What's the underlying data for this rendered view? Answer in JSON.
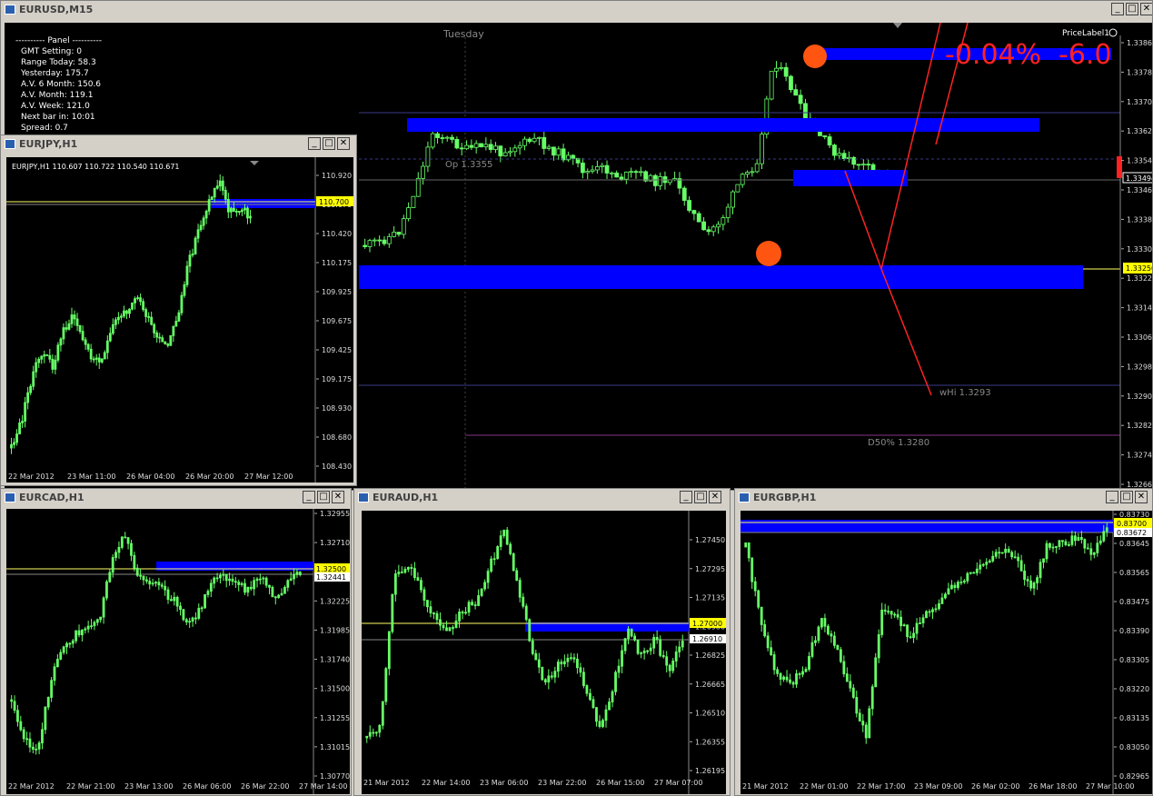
{
  "main": {
    "title": "EURUSD,M15",
    "day_label": "Tuesday",
    "indicator_label": "PriceLabel1",
    "pct_change": "-0.04%",
    "pip_change": "-6.0",
    "op_label": "Op 1.3355",
    "whi_label": "wHi 1.3293",
    "d50_label": "D50% 1.3280",
    "price_current": "1.33494",
    "price_marker": "1.33250",
    "price_axis": [
      "1.33865",
      "1.33785",
      "1.33705",
      "1.33629",
      "1.33545",
      "1.33465",
      "1.33385",
      "1.33305",
      "1.33225",
      "1.33145",
      "1.33065",
      "1.32985",
      "1.32905",
      "1.32825",
      "1.32745",
      "1.32665"
    ],
    "panel": [
      {
        "label": "---------- Panel ----------",
        "value": ""
      },
      {
        "label": "GMT Setting:",
        "value": "0"
      },
      {
        "label": "Range Today:",
        "value": "58.3"
      },
      {
        "label": "Yesterday:",
        "value": "175.7"
      },
      {
        "label": "A.V. 6 Month:",
        "value": "150.6"
      },
      {
        "label": "A.V. Month:",
        "value": "119.1"
      },
      {
        "label": "A.V. Week:",
        "value": "121.0"
      },
      {
        "label": "Next bar in:",
        "value": "10:01"
      },
      {
        "label": "Spread:",
        "value": "0.7"
      }
    ]
  },
  "eurjpy": {
    "title": "EURJPY,H1",
    "info": "EURJPY,H1  110.607 110.722 110.540 110.671",
    "price_axis": [
      "110.920",
      "110.670",
      "110.420",
      "110.175",
      "109.925",
      "109.675",
      "109.425",
      "109.175",
      "108.930",
      "108.680",
      "108.430"
    ],
    "marker_price": "110.700",
    "time_axis": [
      "22 Mar 2012",
      "23 Mar 11:00",
      "26 Mar 04:00",
      "26 Mar 20:00",
      "27 Mar 12:00"
    ]
  },
  "eurcad": {
    "title": "EURCAD,H1",
    "price_axis": [
      "1.32955",
      "1.32710",
      "1.32465",
      "1.32225",
      "1.31985",
      "1.31740",
      "1.31500",
      "1.31255",
      "1.31015",
      "1.30770"
    ],
    "marker_price": "1.32500",
    "current_price": "1.32441",
    "time_axis": [
      "22 Mar 2012",
      "22 Mar 21:00",
      "23 Mar 13:00",
      "26 Mar 06:00",
      "26 Mar 22:00",
      "27 Mar 14:00"
    ]
  },
  "euraud": {
    "title": "EURAUD,H1",
    "price_axis": [
      "1.27450",
      "1.27295",
      "1.27135",
      "1.26980",
      "1.26825",
      "1.26665",
      "1.26510",
      "1.26355",
      "1.26195"
    ],
    "marker_price": "1.27000",
    "current_price": "1.26910",
    "time_axis": [
      "21 Mar 2012",
      "22 Mar 14:00",
      "23 Mar 06:00",
      "23 Mar 22:00",
      "26 Mar 15:00",
      "27 Mar 07:00"
    ]
  },
  "eurgbp": {
    "title": "EURGBP,H1",
    "price_axis": [
      "0.83730",
      "0.83645",
      "0.83565",
      "0.83475",
      "0.83390",
      "0.83305",
      "0.83220",
      "0.83135",
      "0.83050",
      "0.82965"
    ],
    "marker_price": "0.83700",
    "current_price": "0.83672",
    "time_axis": [
      "21 Mar 2012",
      "22 Mar 01:00",
      "22 Mar 17:00",
      "23 Mar 09:00",
      "26 Mar 02:00",
      "26 Mar 18:00",
      "27 Mar 10:00"
    ]
  },
  "colors": {
    "candle": "#66ff66",
    "zone": "#0000ff",
    "bg": "#000000",
    "marker": "#ffff00"
  }
}
